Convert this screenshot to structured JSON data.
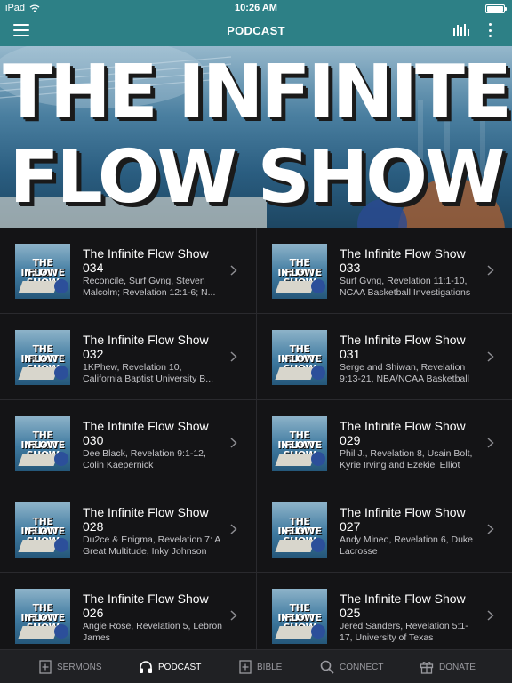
{
  "status_bar": {
    "carrier": "iPad",
    "time": "10:26 AM"
  },
  "nav": {
    "title": "PODCAST"
  },
  "banner": {
    "line1": "THE INFINITE",
    "line2": "FLOW SHOW"
  },
  "thumbnail": {
    "line1": "THE INFINITE",
    "line2": "FLOW SHOW"
  },
  "episodes": [
    {
      "title": "The Infinite Flow Show 034",
      "subtitle": "Reconcile, Surf Gvng, Steven Malcolm; Revelation 12:1-6; N..."
    },
    {
      "title": "The Infinite Flow Show 033",
      "subtitle": "Surf Gvng, Revelation 11:1-10, NCAA Basketball Investigations"
    },
    {
      "title": "The Infinite Flow Show 032",
      "subtitle": "1KPhew, Revelation 10, California Baptist University B..."
    },
    {
      "title": "The Infinite Flow Show 031",
      "subtitle": "Serge and Shiwan, Revelation 9:13-21, NBA/NCAA Basketball"
    },
    {
      "title": "The Infinite Flow Show 030",
      "subtitle": "Dee Black, Revelation 9:1-12, Colin Kaepernick"
    },
    {
      "title": "The Infinite Flow Show 029",
      "subtitle": "Phil J., Revelation 8, Usain Bolt, Kyrie Irving and Ezekiel Elliot"
    },
    {
      "title": "The Infinite Flow Show 028",
      "subtitle": "Du2ce & Enigma, Revelation 7: A Great Multitude, Inky Johnson"
    },
    {
      "title": "The Infinite Flow Show 027",
      "subtitle": "Andy Mineo, Revelation 6, Duke Lacrosse"
    },
    {
      "title": "The Infinite Flow Show 026",
      "subtitle": "Angie Rose, Revelation 5, Lebron James"
    },
    {
      "title": "The Infinite Flow Show 025",
      "subtitle": "Jered Sanders, Revelation 5:1-17, University of Texas"
    }
  ],
  "tabs": [
    {
      "label": "SERMONS",
      "icon": "plus-book-icon",
      "active": false
    },
    {
      "label": "PODCAST",
      "icon": "headphones-icon",
      "active": true
    },
    {
      "label": "BIBLE",
      "icon": "plus-book-icon",
      "active": false
    },
    {
      "label": "CONNECT",
      "icon": "search-icon",
      "active": false
    },
    {
      "label": "DONATE",
      "icon": "gift-icon",
      "active": false
    }
  ],
  "colors": {
    "header": "#2d8086",
    "list_bg": "#141416",
    "tab_bar": "#202124",
    "tab_inactive": "#9a9aa0",
    "tab_active": "#ffffff"
  }
}
